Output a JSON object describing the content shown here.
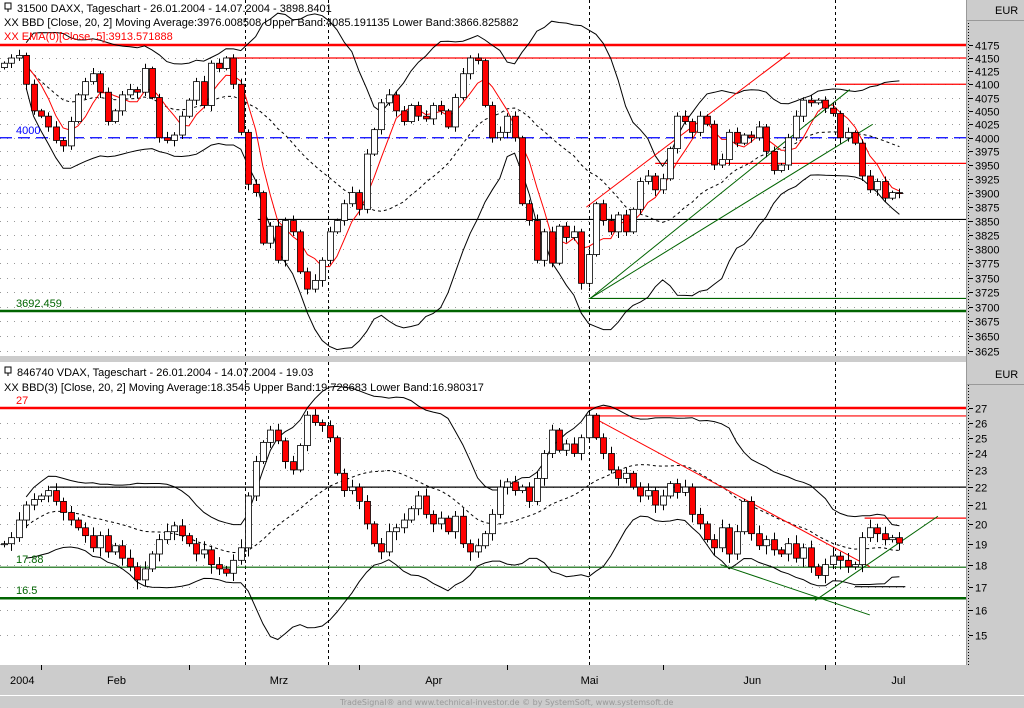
{
  "colors": {
    "up_body": "#ffffff",
    "down_body": "#ff0000",
    "ema": "#ff0000",
    "level_red": "#ff0000",
    "level_green": "#006400",
    "level_blue": "#0000ff",
    "band": "#000000"
  },
  "footer": "TradeSignal® and www.technical-investor.de © by  SystemSoft, www.systemsoft.de",
  "x_axis": {
    "year_label": "2004",
    "months": [
      "Feb",
      "Mrz",
      "Apr",
      "Mai",
      "Jun",
      "Jul"
    ],
    "month_start_index": [
      5,
      25,
      48,
      68,
      89,
      111
    ],
    "month_label_index": [
      15,
      37,
      58,
      79,
      101,
      121
    ]
  },
  "vertical_markers_index": [
    32.5,
    43.8,
    79,
    112.3
  ],
  "chart_data": [
    {
      "type": "candlestick",
      "title": "31500  DAXX, Tageschart - 26.01.2004 - 14.07.2004 - 3898.8401",
      "indicator_bb": "XX BBD [Close, 20, 2] Moving Average:3976.008508 Upper Band:4085.191135 Lower Band:3866.825882",
      "indicator_ema": "XX EMA(0)[Close, 5]:3913.571888",
      "currency": "EUR",
      "scale": "log",
      "ylim": [
        3625,
        4175
      ],
      "yticks": [
        4175,
        4150,
        4125,
        4100,
        4075,
        4050,
        4025,
        4000,
        3975,
        3950,
        3925,
        3900,
        3875,
        3850,
        3825,
        3800,
        3775,
        3750,
        3725,
        3700,
        3675,
        3650,
        3625
      ],
      "close": [
        4140,
        4150,
        4155,
        4100,
        4050,
        4040,
        4020,
        3995,
        3985,
        4030,
        4080,
        4105,
        4120,
        4085,
        4030,
        4050,
        4080,
        4090,
        4085,
        4130,
        4075,
        4000,
        3995,
        4005,
        4040,
        4070,
        4105,
        4060,
        4140,
        4130,
        4150,
        4100,
        4010,
        3915,
        3900,
        3810,
        3840,
        3780,
        3850,
        3830,
        3760,
        3730,
        3745,
        3780,
        3830,
        3850,
        3880,
        3900,
        3870,
        3970,
        4015,
        4065,
        4080,
        4050,
        4030,
        4060,
        4040,
        4035,
        4060,
        4050,
        4020,
        4075,
        4120,
        4150,
        4145,
        4060,
        4000,
        4010,
        4040,
        4000,
        3880,
        3850,
        3780,
        3830,
        3775,
        3840,
        3820,
        3830,
        3740,
        3790,
        3880,
        3850,
        3830,
        3860,
        3830,
        3870,
        3920,
        3930,
        3905,
        3925,
        3980,
        4040,
        4030,
        4010,
        4040,
        4025,
        3950,
        3960,
        4010,
        3990,
        4005,
        4000,
        4020,
        3975,
        3940,
        3950,
        4000,
        4040,
        4070,
        4065,
        4070,
        4055,
        4045,
        4000,
        4010,
        3990,
        3930,
        3905,
        3920,
        3890,
        3900,
        3898.84
      ],
      "levels": [
        {
          "value": 4175,
          "color": "red",
          "from": 0,
          "weight": "thick"
        },
        {
          "value": 4150,
          "color": "red",
          "from": 30.3
        },
        {
          "value": 4100,
          "color": "red",
          "from": 112.3
        },
        {
          "value": 4000,
          "color": "blue",
          "from": 0,
          "dashed": true,
          "label": "4000"
        },
        {
          "value": 3953,
          "color": "red",
          "from": 88
        },
        {
          "value": 3852,
          "color": "black",
          "from": 34.3
        },
        {
          "value": 3714,
          "color": "green",
          "from": 79
        },
        {
          "value": 3692.459,
          "color": "green",
          "from": 0,
          "weight": "thick",
          "label": "3692.459"
        }
      ],
      "trendlines": [
        {
          "color": "red",
          "from": [
            78.7,
            3874
          ],
          "to": [
            106.2,
            4160
          ]
        },
        {
          "color": "green",
          "from": [
            79.2,
            3714
          ],
          "to": [
            114.3,
            4090
          ]
        },
        {
          "color": "green",
          "from": [
            79.2,
            3714
          ],
          "to": [
            117.4,
            4025
          ]
        }
      ]
    },
    {
      "type": "candlestick",
      "title": "846740  VDAX, Tageschart - 26.01.2004 - 14.07.2004 - 19.03",
      "indicator_bb": "XX BBD(3) [Close, 20, 2] Moving Average:18.3545 Upper Band:19.728683 Lower Band:16.980317",
      "currency": "EUR",
      "scale": "log",
      "ylim": [
        15,
        27
      ],
      "yticks": [
        27,
        26,
        25,
        24,
        23,
        22,
        21,
        20,
        19,
        18,
        17,
        16,
        15
      ],
      "close": [
        19,
        19.3,
        20.2,
        21,
        21.3,
        21.5,
        21.8,
        21.2,
        20.6,
        20.2,
        19.8,
        19.4,
        18.8,
        19.4,
        18.6,
        18.9,
        18.3,
        17.9,
        17.3,
        17.8,
        18.5,
        19.2,
        19.6,
        19.9,
        19.4,
        19,
        18.5,
        18.7,
        18,
        17.8,
        17.6,
        18.2,
        18.8,
        21.5,
        23.5,
        24.7,
        25.5,
        24.8,
        23.5,
        23,
        24.5,
        26.5,
        26,
        25.8,
        25,
        22.8,
        21.8,
        22,
        21.2,
        20,
        19,
        18.6,
        19.6,
        19.8,
        20.2,
        20.8,
        21.5,
        20.5,
        20,
        20.3,
        19.6,
        20.4,
        19,
        18.6,
        18.9,
        19.5,
        20.5,
        22,
        22.3,
        21.8,
        22,
        21.2,
        22.5,
        24,
        25.5,
        24.2,
        24.6,
        24,
        25,
        26.5,
        25,
        24,
        23,
        22.5,
        22.8,
        22,
        21.5,
        21.8,
        21,
        21.5,
        22.2,
        21.7,
        22,
        20.5,
        20,
        19.2,
        18.8,
        19.8,
        18.5,
        19.6,
        21.2,
        19.5,
        18.9,
        19.2,
        18.7,
        18.5,
        19,
        18.3,
        18.8,
        17.9,
        17.5,
        18,
        18.4,
        18.2,
        17.9,
        18,
        19.3,
        19.8,
        19.5,
        19.2,
        19.3,
        19.03
      ],
      "levels": [
        {
          "value": 27,
          "color": "red",
          "from": 0,
          "weight": "thick",
          "label": "27"
        },
        {
          "value": 26.45,
          "color": "red",
          "from": 79
        },
        {
          "value": 22,
          "color": "black",
          "from": 6.2
        },
        {
          "value": 20.3,
          "color": "red",
          "from": 116.3
        },
        {
          "value": 17.88,
          "color": "green",
          "from": 0,
          "label": "17.88"
        },
        {
          "value": 17,
          "color": "black",
          "from": 115,
          "to": 121.8
        },
        {
          "value": 16.5,
          "color": "green",
          "from": 0,
          "weight": "thick",
          "label": "16.5"
        }
      ],
      "trendlines": [
        {
          "color": "red",
          "from": [
            79.2,
            26.45
          ],
          "to": [
            117,
            17.9
          ]
        },
        {
          "color": "green",
          "from": [
            96.8,
            18.0
          ],
          "to": [
            117,
            15.8
          ]
        },
        {
          "color": "green",
          "from": [
            109.6,
            16.4
          ],
          "to": [
            126.2,
            20.4
          ]
        }
      ]
    }
  ]
}
